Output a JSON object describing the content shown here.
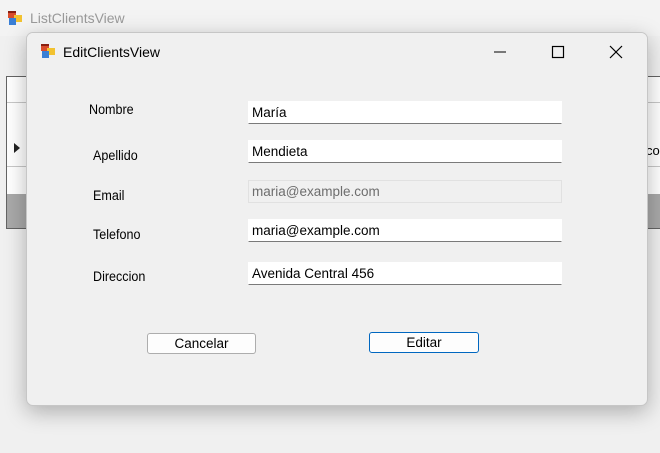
{
  "background_window": {
    "title": "ListClientsView",
    "grid_partial_cell_text": "co"
  },
  "dialog": {
    "title": "EditClientsView",
    "window_controls": {
      "minimize": "minimize-icon",
      "maximize": "maximize-icon",
      "close": "close-icon"
    },
    "fields": {
      "nombre": {
        "label": "Nombre",
        "value": "María"
      },
      "apellido": {
        "label": "Apellido",
        "value": "Mendieta"
      },
      "email": {
        "label": "Email",
        "value": "maria@example.com",
        "readonly": true
      },
      "telefono": {
        "label": "Telefono",
        "value": "maria@example.com"
      },
      "direccion": {
        "label": "Direccion",
        "value": "Avenida Central 456"
      }
    },
    "buttons": {
      "cancel_label": "Cancelar",
      "edit_label": "Editar"
    }
  },
  "colors": {
    "accent": "#0067c0",
    "window_bg": "#f0f0f0"
  }
}
